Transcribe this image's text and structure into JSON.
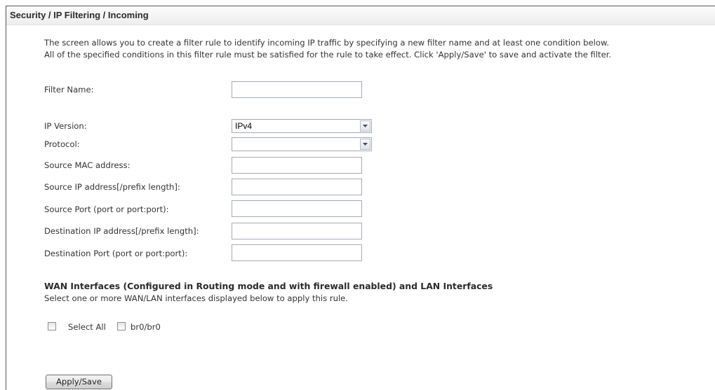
{
  "page": {
    "title": "Security / IP Filtering / Incoming",
    "description_line1": "The screen allows you to create a filter rule to identify incoming IP traffic by specifying a new filter name and at least one condition below.",
    "description_line2": "All of the specified conditions in this filter rule must be satisfied for the rule to take effect. Click 'Apply/Save' to save and activate the filter."
  },
  "form": {
    "filter_name": {
      "label": "Filter Name:",
      "value": ""
    },
    "ip_version": {
      "label": "IP Version:",
      "value": "IPv4"
    },
    "protocol": {
      "label": "Protocol:",
      "value": ""
    },
    "source_mac": {
      "label": "Source MAC address:",
      "value": ""
    },
    "source_ip": {
      "label": "Source IP address[/prefix length]:",
      "value": ""
    },
    "source_port": {
      "label": "Source Port (port or port:port):",
      "value": ""
    },
    "destination_ip": {
      "label": "Destination IP address[/prefix length]:",
      "value": ""
    },
    "destination_port": {
      "label": "Destination Port (port or port:port):",
      "value": ""
    }
  },
  "interfaces": {
    "title": "WAN Interfaces (Configured in Routing mode and with firewall enabled) and LAN Interfaces",
    "subtitle": "Select one or more WAN/LAN interfaces displayed below to apply this rule.",
    "select_all_label": "Select All",
    "items": [
      {
        "label": "br0/br0",
        "checked": false
      }
    ]
  },
  "actions": {
    "apply_label": "Apply/Save"
  },
  "icons": {
    "dropdown": "chevron-down-icon"
  }
}
